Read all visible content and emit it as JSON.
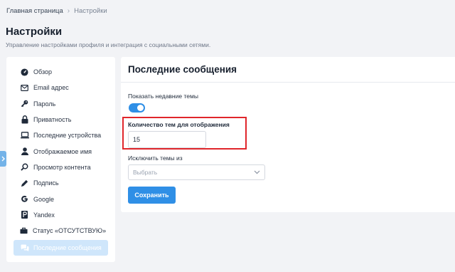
{
  "breadcrumb": {
    "home": "Главная страница",
    "separator": "›",
    "current": "Настройки"
  },
  "page": {
    "title": "Настройки",
    "subtitle": "Управление настройками профиля и интеграция с социальными сетями."
  },
  "sidebar": {
    "items": [
      {
        "label": "Обзор",
        "icon": "dashboard-icon"
      },
      {
        "label": "Email адрес",
        "icon": "mail-icon"
      },
      {
        "label": "Пароль",
        "icon": "key-icon"
      },
      {
        "label": "Приватность",
        "icon": "lock-icon"
      },
      {
        "label": "Последние устройства",
        "icon": "laptop-icon"
      },
      {
        "label": "Отображаемое имя",
        "icon": "user-icon"
      },
      {
        "label": "Просмотр контента",
        "icon": "magnifier-icon"
      },
      {
        "label": "Подпись",
        "icon": "pen-icon"
      },
      {
        "label": "Google",
        "icon": "google-icon"
      },
      {
        "label": "Yandex",
        "icon": "yandex-icon"
      },
      {
        "label": "Статус «ОТСУТСТВУЮ»",
        "icon": "briefcase-icon"
      },
      {
        "label": "Последние сообщения",
        "icon": "chat-icon",
        "active": true
      }
    ]
  },
  "panel": {
    "title": "Последние сообщения",
    "show_recent_label": "Показать недавние темы",
    "show_recent_enabled": true,
    "count_label": "Количество тем для отображения",
    "count_value": "15",
    "exclude_label": "Исключить темы из",
    "exclude_placeholder": "Выбрать",
    "save_label": "Сохранить"
  },
  "colors": {
    "accent": "#2f8fe6",
    "highlight": "#e0262b",
    "active_bg": "#cfe6fb"
  }
}
